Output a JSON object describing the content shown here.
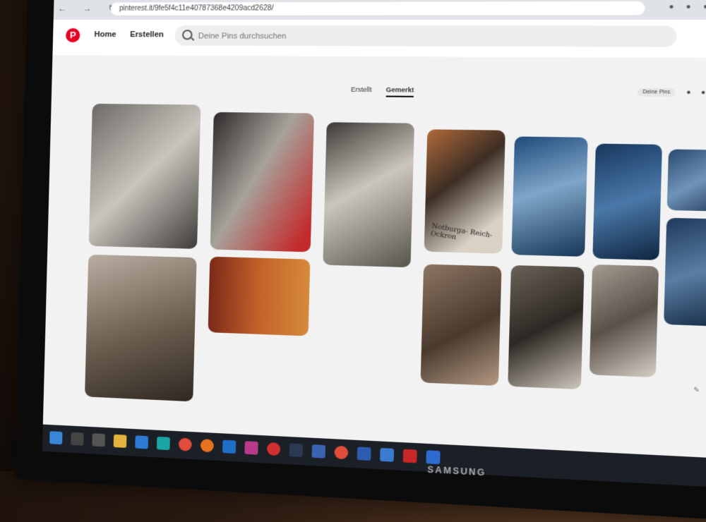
{
  "browser": {
    "url": "pinterest.it/9fe5f4c11e40787368e4209acd2628/"
  },
  "header": {
    "logo_icon": "pinterest-logo",
    "logo_color": "#e60023",
    "home_label": "Home",
    "create_label": "Erstellen",
    "search_placeholder": "Deine Pins durchsuchen"
  },
  "profile": {
    "tabs": [
      {
        "label": "Erstellt",
        "active": false
      },
      {
        "label": "Gemerkt",
        "active": true
      }
    ],
    "sort_label": "Deine Pins"
  },
  "pins": [
    {
      "caption": ""
    },
    {
      "caption": ""
    },
    {
      "caption": ""
    },
    {
      "caption": "Notburga- Reich- Ockron"
    },
    {
      "caption": ""
    },
    {
      "caption": ""
    },
    {
      "caption": ""
    },
    {
      "caption": ""
    },
    {
      "caption": ""
    },
    {
      "caption": ""
    },
    {
      "caption": ""
    },
    {
      "caption": ""
    },
    {
      "caption": ""
    }
  ],
  "help_label": "?",
  "monitor_brand": "SAMSUNG",
  "taskbar_icons": [
    "windows-start-icon",
    "search-icon",
    "task-view-icon",
    "file-explorer-icon",
    "mail-icon",
    "edge-icon",
    "chrome-icon",
    "firefox-icon",
    "outlook-icon",
    "app-icon",
    "opera-icon",
    "lightroom-icon",
    "app-icon",
    "chrome-icon",
    "word-icon",
    "app-icon",
    "acrobat-icon",
    "app-icon"
  ]
}
